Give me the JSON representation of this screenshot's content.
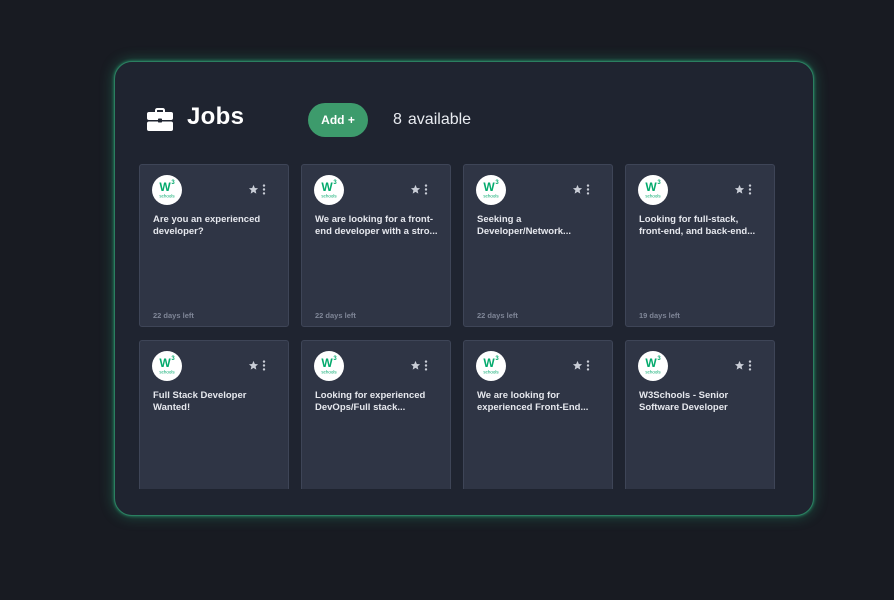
{
  "header": {
    "title": "Jobs",
    "add_label": "Add +",
    "count": "8",
    "count_suffix": "available"
  },
  "logo": {
    "mark": "W",
    "superscript": "3",
    "caption": "schools",
    "color": "#04aa6d"
  },
  "colors": {
    "accent": "#3d9b6c",
    "panel_border": "#2b7f60",
    "card_bg": "#2f3545"
  },
  "jobs": [
    {
      "text": "Are you an experienced developer?",
      "days_left": "22 days left"
    },
    {
      "text": "We are looking for a front-end developer with a stro...",
      "days_left": "22 days left"
    },
    {
      "text": "Seeking a Developer/Network...",
      "days_left": "22 days left"
    },
    {
      "text": "Looking for full-stack, front-end, and back-end...",
      "days_left": "19 days left"
    },
    {
      "text": "Full Stack Developer Wanted!",
      "days_left": ""
    },
    {
      "text": "Looking for experienced DevOps/Full stack...",
      "days_left": ""
    },
    {
      "text": "We are looking for experienced Front-End...",
      "days_left": ""
    },
    {
      "text": "W3Schools - Senior Software Developer",
      "days_left": ""
    }
  ]
}
